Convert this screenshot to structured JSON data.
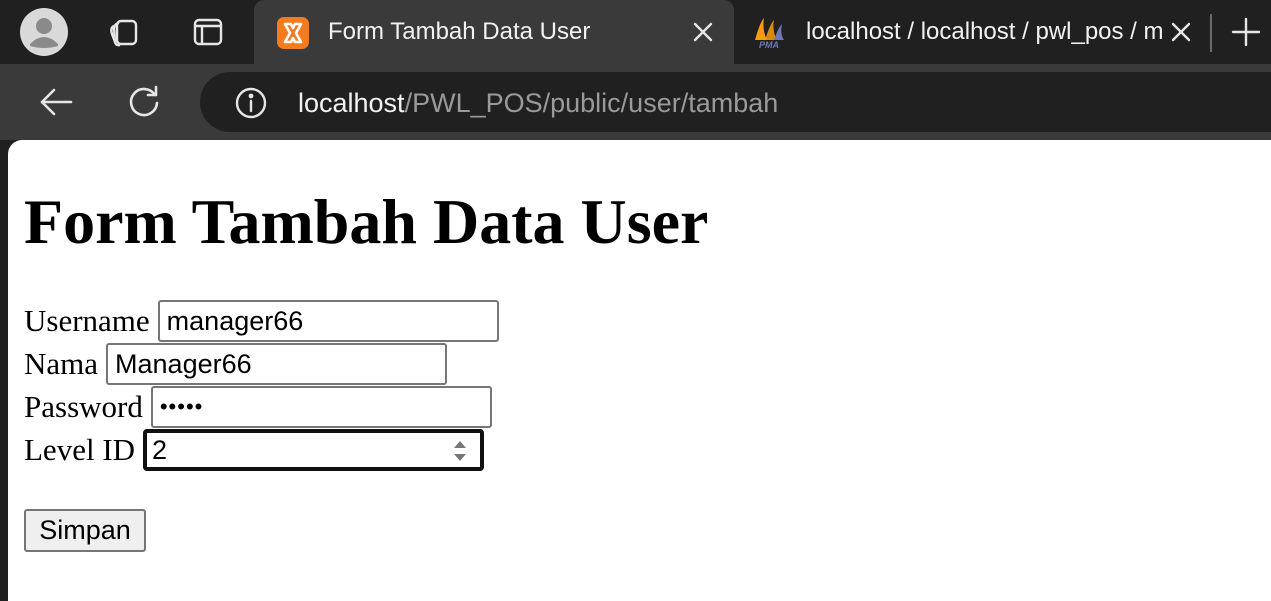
{
  "browser": {
    "tabs": [
      {
        "title": "Form Tambah Data User",
        "favicon": "xampp-icon",
        "active": true
      },
      {
        "title": "localhost / localhost / pwl_pos / m",
        "favicon": "phpmyadmin-icon",
        "active": false
      }
    ],
    "url": {
      "host": "localhost",
      "path": "/PWL_POS/public/user/tambah"
    }
  },
  "page": {
    "heading": "Form Tambah Data User",
    "form": {
      "username": {
        "label": "Username",
        "value": "manager66"
      },
      "nama": {
        "label": "Nama",
        "value": "Manager66"
      },
      "password": {
        "label": "Password",
        "value": "•••••"
      },
      "level_id": {
        "label": "Level ID",
        "value": "2"
      },
      "submit_label": "Simpan"
    }
  },
  "colors": {
    "xampp_orange": "#f47c20",
    "pma_orange": "#f89c0e",
    "pma_blue": "#6c78af"
  }
}
